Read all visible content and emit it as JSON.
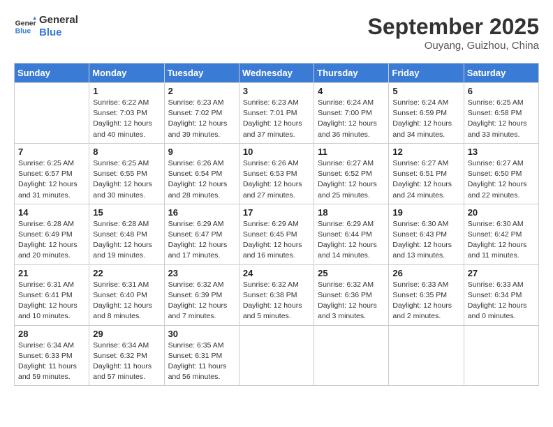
{
  "header": {
    "logo_line1": "General",
    "logo_line2": "Blue",
    "month": "September 2025",
    "location": "Ouyang, Guizhou, China"
  },
  "weekdays": [
    "Sunday",
    "Monday",
    "Tuesday",
    "Wednesday",
    "Thursday",
    "Friday",
    "Saturday"
  ],
  "weeks": [
    [
      {
        "day": "",
        "info": ""
      },
      {
        "day": "1",
        "info": "Sunrise: 6:22 AM\nSunset: 7:03 PM\nDaylight: 12 hours\nand 40 minutes."
      },
      {
        "day": "2",
        "info": "Sunrise: 6:23 AM\nSunset: 7:02 PM\nDaylight: 12 hours\nand 39 minutes."
      },
      {
        "day": "3",
        "info": "Sunrise: 6:23 AM\nSunset: 7:01 PM\nDaylight: 12 hours\nand 37 minutes."
      },
      {
        "day": "4",
        "info": "Sunrise: 6:24 AM\nSunset: 7:00 PM\nDaylight: 12 hours\nand 36 minutes."
      },
      {
        "day": "5",
        "info": "Sunrise: 6:24 AM\nSunset: 6:59 PM\nDaylight: 12 hours\nand 34 minutes."
      },
      {
        "day": "6",
        "info": "Sunrise: 6:25 AM\nSunset: 6:58 PM\nDaylight: 12 hours\nand 33 minutes."
      }
    ],
    [
      {
        "day": "7",
        "info": "Sunrise: 6:25 AM\nSunset: 6:57 PM\nDaylight: 12 hours\nand 31 minutes."
      },
      {
        "day": "8",
        "info": "Sunrise: 6:25 AM\nSunset: 6:55 PM\nDaylight: 12 hours\nand 30 minutes."
      },
      {
        "day": "9",
        "info": "Sunrise: 6:26 AM\nSunset: 6:54 PM\nDaylight: 12 hours\nand 28 minutes."
      },
      {
        "day": "10",
        "info": "Sunrise: 6:26 AM\nSunset: 6:53 PM\nDaylight: 12 hours\nand 27 minutes."
      },
      {
        "day": "11",
        "info": "Sunrise: 6:27 AM\nSunset: 6:52 PM\nDaylight: 12 hours\nand 25 minutes."
      },
      {
        "day": "12",
        "info": "Sunrise: 6:27 AM\nSunset: 6:51 PM\nDaylight: 12 hours\nand 24 minutes."
      },
      {
        "day": "13",
        "info": "Sunrise: 6:27 AM\nSunset: 6:50 PM\nDaylight: 12 hours\nand 22 minutes."
      }
    ],
    [
      {
        "day": "14",
        "info": "Sunrise: 6:28 AM\nSunset: 6:49 PM\nDaylight: 12 hours\nand 20 minutes."
      },
      {
        "day": "15",
        "info": "Sunrise: 6:28 AM\nSunset: 6:48 PM\nDaylight: 12 hours\nand 19 minutes."
      },
      {
        "day": "16",
        "info": "Sunrise: 6:29 AM\nSunset: 6:47 PM\nDaylight: 12 hours\nand 17 minutes."
      },
      {
        "day": "17",
        "info": "Sunrise: 6:29 AM\nSunset: 6:45 PM\nDaylight: 12 hours\nand 16 minutes."
      },
      {
        "day": "18",
        "info": "Sunrise: 6:29 AM\nSunset: 6:44 PM\nDaylight: 12 hours\nand 14 minutes."
      },
      {
        "day": "19",
        "info": "Sunrise: 6:30 AM\nSunset: 6:43 PM\nDaylight: 12 hours\nand 13 minutes."
      },
      {
        "day": "20",
        "info": "Sunrise: 6:30 AM\nSunset: 6:42 PM\nDaylight: 12 hours\nand 11 minutes."
      }
    ],
    [
      {
        "day": "21",
        "info": "Sunrise: 6:31 AM\nSunset: 6:41 PM\nDaylight: 12 hours\nand 10 minutes."
      },
      {
        "day": "22",
        "info": "Sunrise: 6:31 AM\nSunset: 6:40 PM\nDaylight: 12 hours\nand 8 minutes."
      },
      {
        "day": "23",
        "info": "Sunrise: 6:32 AM\nSunset: 6:39 PM\nDaylight: 12 hours\nand 7 minutes."
      },
      {
        "day": "24",
        "info": "Sunrise: 6:32 AM\nSunset: 6:38 PM\nDaylight: 12 hours\nand 5 minutes."
      },
      {
        "day": "25",
        "info": "Sunrise: 6:32 AM\nSunset: 6:36 PM\nDaylight: 12 hours\nand 3 minutes."
      },
      {
        "day": "26",
        "info": "Sunrise: 6:33 AM\nSunset: 6:35 PM\nDaylight: 12 hours\nand 2 minutes."
      },
      {
        "day": "27",
        "info": "Sunrise: 6:33 AM\nSunset: 6:34 PM\nDaylight: 12 hours\nand 0 minutes."
      }
    ],
    [
      {
        "day": "28",
        "info": "Sunrise: 6:34 AM\nSunset: 6:33 PM\nDaylight: 11 hours\nand 59 minutes."
      },
      {
        "day": "29",
        "info": "Sunrise: 6:34 AM\nSunset: 6:32 PM\nDaylight: 11 hours\nand 57 minutes."
      },
      {
        "day": "30",
        "info": "Sunrise: 6:35 AM\nSunset: 6:31 PM\nDaylight: 11 hours\nand 56 minutes."
      },
      {
        "day": "",
        "info": ""
      },
      {
        "day": "",
        "info": ""
      },
      {
        "day": "",
        "info": ""
      },
      {
        "day": "",
        "info": ""
      }
    ]
  ]
}
